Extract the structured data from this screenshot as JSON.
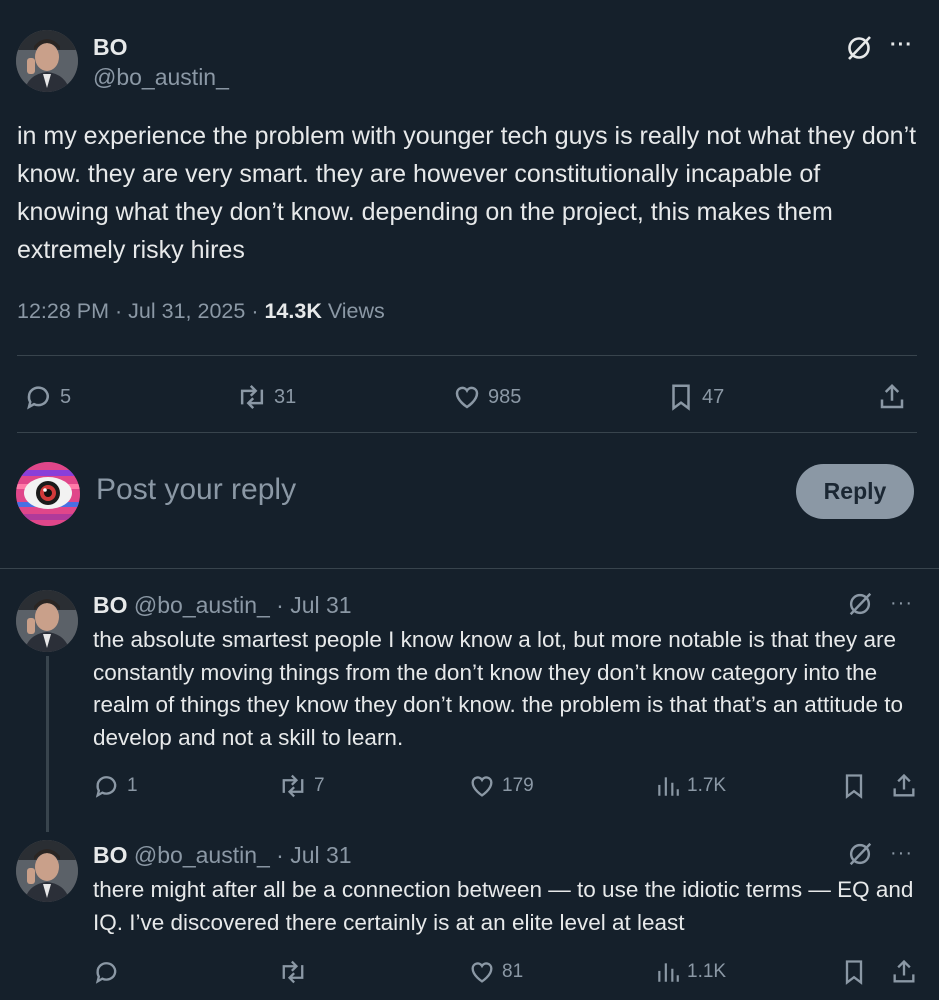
{
  "main_post": {
    "author_name": "BO",
    "author_handle": "@bo_austin_",
    "text": "in my experience the problem with younger tech guys is really not what they don’t know. they are very smart. they are however constitutionally incapable of knowing what they don’t know. depending on the project, this makes them extremely risky hires",
    "time": "12:28 PM",
    "date": "Jul 31, 2025",
    "sep": "·",
    "views_count": "14.3K",
    "views_label": "Views",
    "stats": {
      "replies": "5",
      "reposts": "31",
      "likes": "985",
      "bookmarks": "47"
    }
  },
  "reply_box": {
    "placeholder": "Post your reply",
    "button": "Reply"
  },
  "replies": [
    {
      "author_name": "BO",
      "author_handle": "@bo_austin_",
      "date": "· Jul 31",
      "text": "the absolute smartest people I know know a lot, but more notable is that they are constantly moving things from the don’t know they don’t know category into the realm of things they know they don’t know. the problem is that that’s an attitude to develop and not a skill to learn.",
      "stats": {
        "replies": "1",
        "reposts": "7",
        "likes": "179",
        "views": "1.7K"
      }
    },
    {
      "author_name": "BO",
      "author_handle": "@bo_austin_",
      "date": "· Jul 31",
      "text": "there might after all be a connection between — to use the idiotic terms — EQ and IQ. I’ve discovered there certainly is at an elite level at least",
      "stats": {
        "replies": "",
        "reposts": "",
        "likes": "81",
        "views": "1.1K"
      }
    }
  ],
  "icons": {
    "more": "more-icon",
    "grok": "slash-circle-icon",
    "reply": "reply-icon",
    "repost": "repost-icon",
    "like": "heart-icon",
    "bookmark": "bookmark-icon",
    "share": "share-icon",
    "views": "views-icon"
  },
  "colors": {
    "background": "#15202b",
    "text": "#e7e9ea",
    "muted": "#8b98a5",
    "divider": "#38444d",
    "reply_button_bg": "#8b98a5"
  }
}
